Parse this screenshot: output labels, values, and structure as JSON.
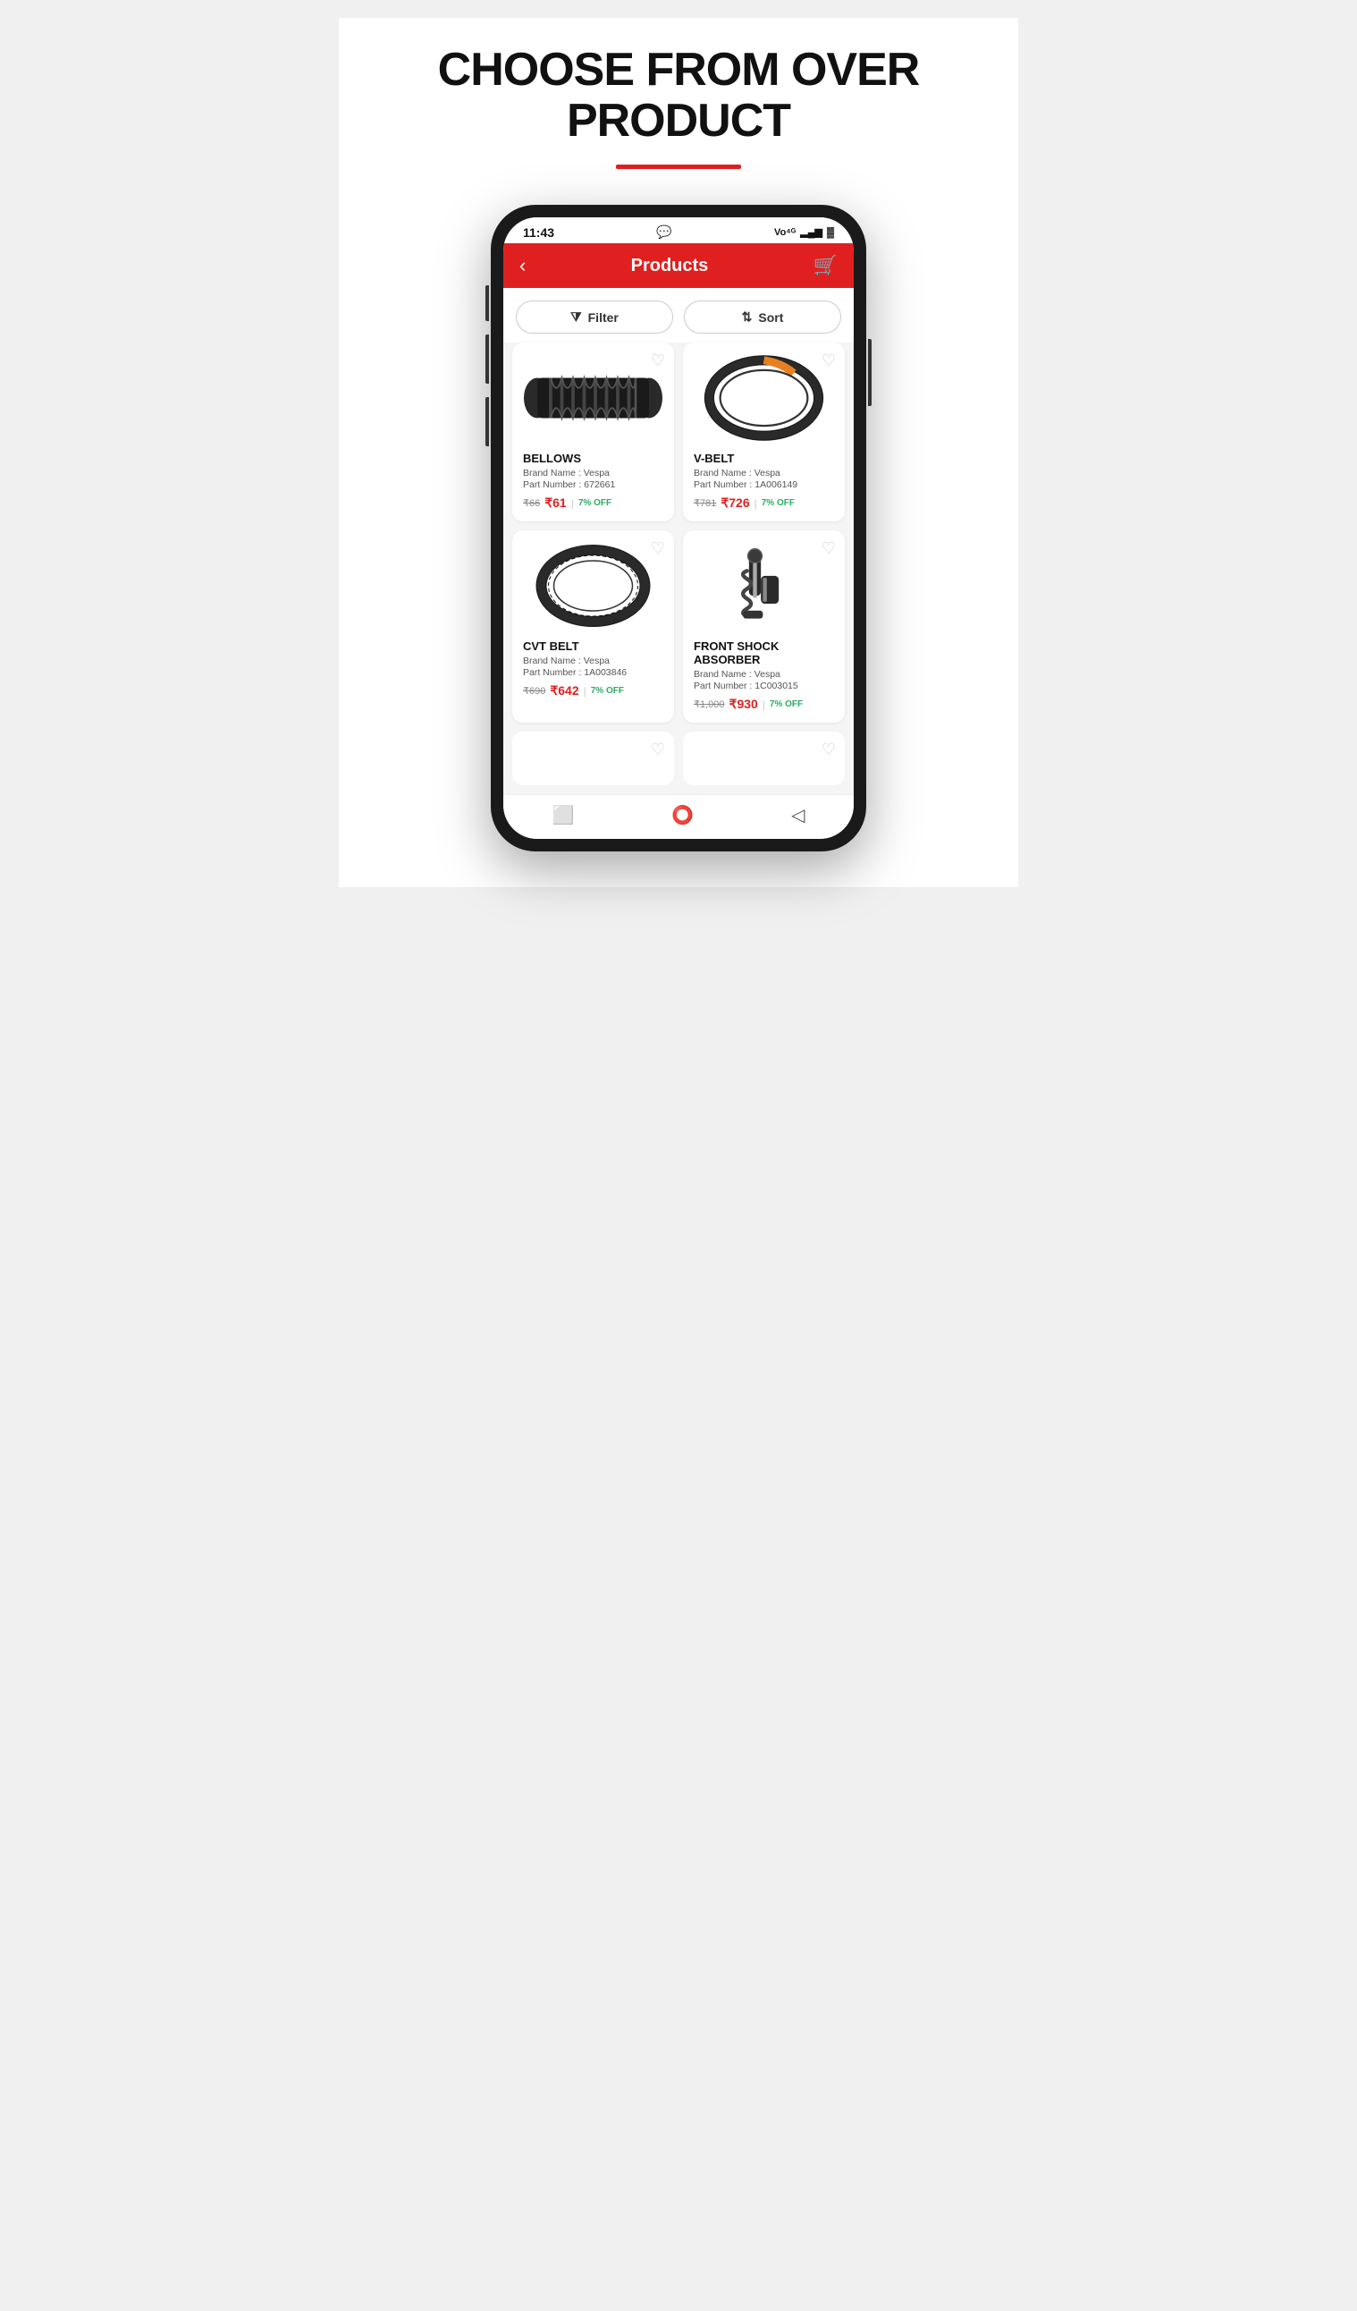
{
  "hero": {
    "title": "CHOOSE FROM OVER PRODUCT",
    "divider_color": "#e02020"
  },
  "status_bar": {
    "time": "11:43",
    "whatsapp": "💬",
    "network": "Vo 4G",
    "battery": "🔋"
  },
  "header": {
    "title": "Products",
    "back_label": "‹",
    "cart_label": "🛒"
  },
  "filter_btn": "Filter",
  "sort_btn": "Sort",
  "products": [
    {
      "id": "bellows",
      "name": "BELLOWS",
      "brand": "Brand Name : Vespa",
      "part": "Part Number : 672661",
      "price_original": "₹66",
      "price_discounted": "₹61",
      "discount": "7% OFF"
    },
    {
      "id": "vbelt",
      "name": "V-BELT",
      "brand": "Brand Name : Vespa",
      "part": "Part Number : 1A006149",
      "price_original": "₹781",
      "price_discounted": "₹726",
      "discount": "7% OFF"
    },
    {
      "id": "cvtbelt",
      "name": "CVT BELT",
      "brand": "Brand Name : Vespa",
      "part": "Part Number : 1A003846",
      "price_original": "₹690",
      "price_discounted": "₹642",
      "discount": "7% OFF"
    },
    {
      "id": "frontshock",
      "name": "FRONT SHOCK ABSORBER",
      "brand": "Brand Name : Vespa",
      "part": "Part Number : 1C003015",
      "price_original": "₹1,000",
      "price_discounted": "₹930",
      "discount": "7% OFF"
    }
  ],
  "nav": {
    "square": "⬜",
    "circle": "⭕",
    "triangle": "◁"
  }
}
